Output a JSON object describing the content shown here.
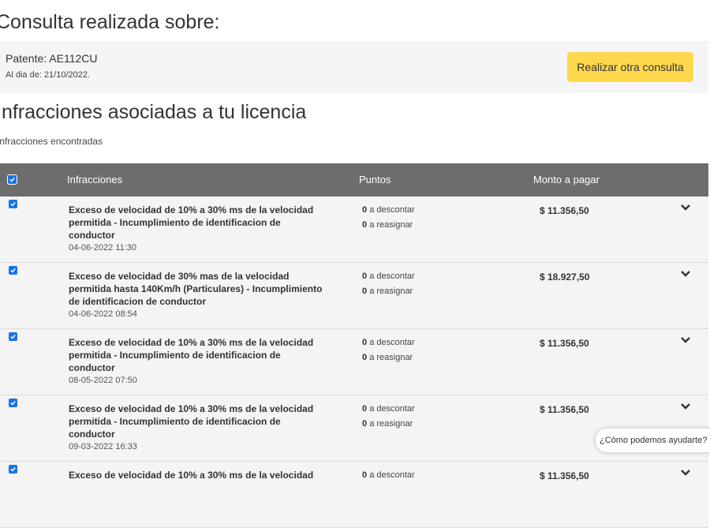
{
  "page": {
    "title": "Consulta realizada sobre:",
    "plate": "Patente: AE112CU",
    "as_of": "Al dia de: 21/10/2022.",
    "new_query_button": "Realizar otra consulta",
    "section_title": "Infracciones asociadas a tu licencia",
    "found_text": "Infracciones encontradas"
  },
  "table": {
    "headers": {
      "infractions": "Infracciones",
      "points": "Puntos",
      "amount": "Monto a pagar"
    },
    "rows": [
      {
        "title": "Exceso de velocidad de 10% a 30% ms de la velocidad permitida - Incumplimiento de identificacion de conductor",
        "date": "04-06-2022 11:30",
        "points_deduct": "0",
        "points_deduct_label": "a descontar",
        "points_reassign": "0",
        "points_reassign_label": "a reasignar",
        "amount": "$ 11.356,50"
      },
      {
        "title": "Exceso de velocidad de 30% mas de la velocidad permitida hasta 140Km/h (Particulares) - Incumplimiento de identificacion de conductor",
        "date": "04-06-2022 08:54",
        "points_deduct": "0",
        "points_deduct_label": "a descontar",
        "points_reassign": "0",
        "points_reassign_label": "a reasignar",
        "amount": "$ 18.927,50"
      },
      {
        "title": "Exceso de velocidad de 10% a 30% ms de la velocidad permitida - Incumplimiento de identificacion de conductor",
        "date": "08-05-2022 07:50",
        "points_deduct": "0",
        "points_deduct_label": "a descontar",
        "points_reassign": "0",
        "points_reassign_label": "a reasignar",
        "amount": "$ 11.356,50"
      },
      {
        "title": "Exceso de velocidad de 10% a 30% ms de la velocidad permitida - Incumplimiento de identificacion de conductor",
        "date": "09-03-2022 16:33",
        "points_deduct": "0",
        "points_deduct_label": "a descontar",
        "points_reassign": "0",
        "points_reassign_label": "a reasignar",
        "amount": "$ 11.356,50"
      },
      {
        "title": "Exceso de velocidad de 10% a 30% ms de la velocidad",
        "date": "",
        "points_deduct": "0",
        "points_deduct_label": "a descontar",
        "points_reassign": "",
        "points_reassign_label": "",
        "amount": "$ 11.356,50"
      }
    ]
  },
  "help": {
    "label": "¿Cómo podemos ayudarte?"
  },
  "colors": {
    "accent_button": "#ffd84d",
    "table_header": "#6d6d6d",
    "checkbox": "#1a73e8",
    "row_background": "#f4f4f4"
  },
  "icons": {
    "checkbox": "checkbox-checked-icon",
    "expand": "chevron-down-icon"
  }
}
